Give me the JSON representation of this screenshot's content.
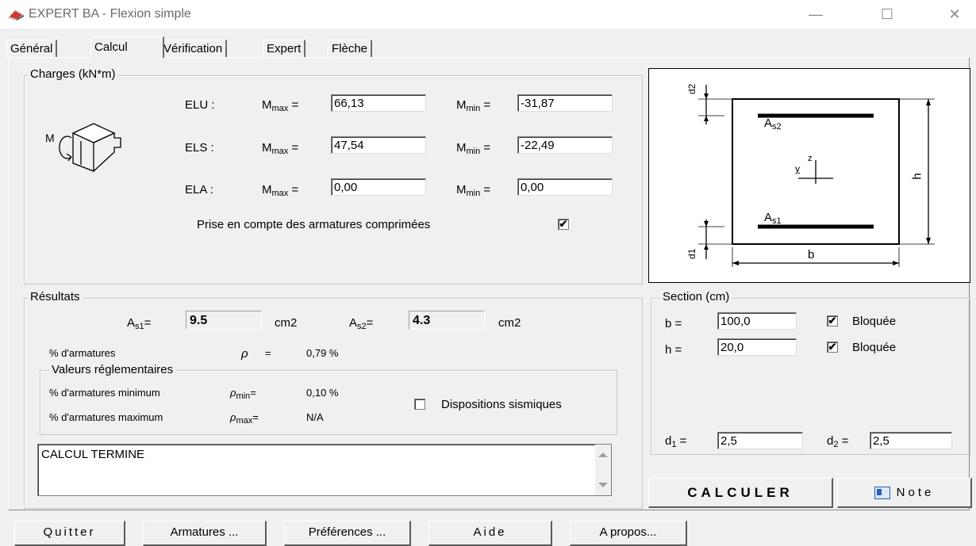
{
  "window": {
    "title": "EXPERT BA - Flexion simple",
    "min": "—",
    "max": "☐",
    "close": "✕"
  },
  "tabs": [
    {
      "label": "Général"
    },
    {
      "label": "Calcul"
    },
    {
      "label": "Vérification"
    },
    {
      "label": "Expert"
    },
    {
      "label": "Flèche"
    }
  ],
  "charges": {
    "legend": "Charges (kN*m)",
    "moment_letter": "M",
    "rows": [
      {
        "label": "ELU :",
        "mmax": "66,13",
        "mmin": "-31,87"
      },
      {
        "label": "ELS :",
        "mmax": "47,54",
        "mmin": "-22,49"
      },
      {
        "label": "ELA :",
        "mmax": "0,00",
        "mmin": "0,00"
      }
    ],
    "mmax_prefix": "M",
    "mmax_sub": "max",
    "mmin_prefix": "M",
    "mmin_sub": "min",
    "eq": "=",
    "prise_label": "Prise en compte des armatures comprimées",
    "prise_checked": "✔"
  },
  "diagram": {
    "as2": "A",
    "as2_sub": "s2",
    "as1": "A",
    "as1_sub": "s1",
    "z": "z",
    "y": "y",
    "h": "h",
    "b": "b"
  },
  "resultats": {
    "legend": "Résultats",
    "as1_label": "A",
    "as1_sub": "s1",
    "as1_eq": "=",
    "as1_value": "9.5",
    "as1_unit": "cm2",
    "as2_label": "A",
    "as2_sub": "s2",
    "as2_eq": "=",
    "as2_value": "4.3",
    "as2_unit": "cm2",
    "pct_label": "% d'armatures",
    "rho": "ρ",
    "rho_eq": "=",
    "pct_value": "0,79 %",
    "valeurs_legend": "Valeurs réglementaires",
    "min_label": "% d'armatures minimum",
    "min_sub": "min",
    "min_eq": "=",
    "min_value": "0,10 %",
    "max_label": "% d'armatures maximum",
    "max_sub": "max",
    "max_eq": "=",
    "max_value": "N/A",
    "sismique_label": "Dispositions sismiques",
    "message": "CALCUL TERMINE"
  },
  "section": {
    "legend": "Section (cm)",
    "b_label": "b =",
    "b_value": "100,0",
    "b_lock": "Bloquée",
    "b_checked": "✔",
    "h_label": "h =",
    "h_value": "20,0",
    "h_lock": "Bloquée",
    "h_checked": "✔",
    "d1_label": "d",
    "d1_sub": "1",
    "d1_eq": "=",
    "d1_value": "2,5",
    "d2_label": "d",
    "d2_sub": "2",
    "d2_eq": "=",
    "d2_value": "2,5"
  },
  "actions": {
    "calculer": "CALCULER",
    "note": "Note"
  },
  "bottom": [
    "Quitter",
    "Armatures ...",
    "Préférences ...",
    "Aide",
    "A propos..."
  ],
  "colors": {
    "accent_icon": "#d23a2a",
    "note_icon": "#2a5fb0"
  }
}
